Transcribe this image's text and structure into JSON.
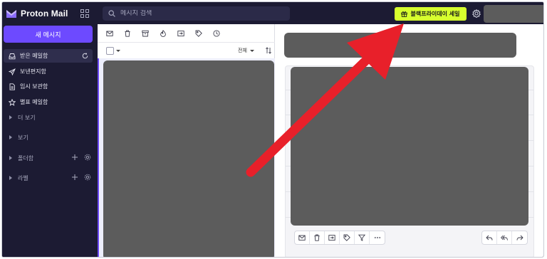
{
  "app": {
    "brand": "Proton Mail"
  },
  "search": {
    "placeholder": "메시지 검색"
  },
  "promo": {
    "label": "블랙프라이데이 세일"
  },
  "sidebar": {
    "compose_label": "새 메시지",
    "items": [
      {
        "label": "받은 메일함",
        "icon": "inbox-icon",
        "active": true
      },
      {
        "label": "보낸편지함",
        "icon": "send-icon"
      },
      {
        "label": "임시 보관함",
        "icon": "draft-icon"
      },
      {
        "label": "별표 메일함",
        "icon": "star-icon"
      }
    ],
    "groups": [
      {
        "label": "더 보기"
      },
      {
        "label": "보기"
      },
      {
        "label": "폴더함"
      },
      {
        "label": "라벨"
      }
    ]
  },
  "list": {
    "filter_label": "전체"
  },
  "colors": {
    "accent": "#6d4aff",
    "promo": "#d7ff2e",
    "sidebar_bg": "#1c1b33",
    "annotation_arrow": "#e8202a"
  }
}
